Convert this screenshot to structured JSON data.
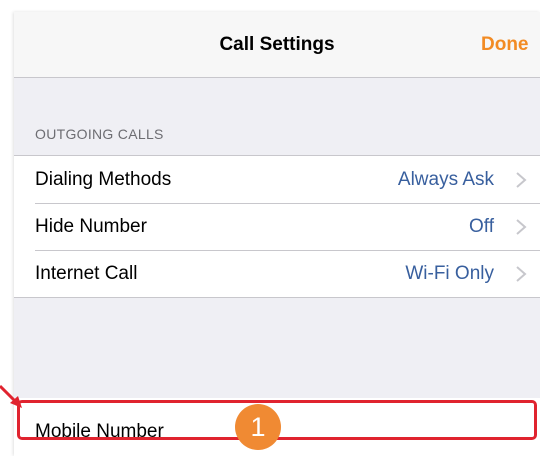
{
  "header": {
    "title": "Call Settings",
    "done_label": "Done"
  },
  "outgoing": {
    "section_title": "OUTGOING CALLS",
    "rows": [
      {
        "label": "Dialing Methods",
        "value": "Always Ask"
      },
      {
        "label": "Hide Number",
        "value": "Off"
      },
      {
        "label": "Internet Call",
        "value": "Wi-Fi Only"
      }
    ]
  },
  "mobile": {
    "label": "Mobile Number"
  },
  "annotation": {
    "badge_number": "1"
  },
  "colors": {
    "accent": "#f28b24",
    "value_text": "#385f9e",
    "highlight": "#e0232f",
    "background": "#efeff4"
  },
  "icons": {
    "row_disclosure": "chevron-right-icon",
    "pointer": "arrow-icon"
  }
}
